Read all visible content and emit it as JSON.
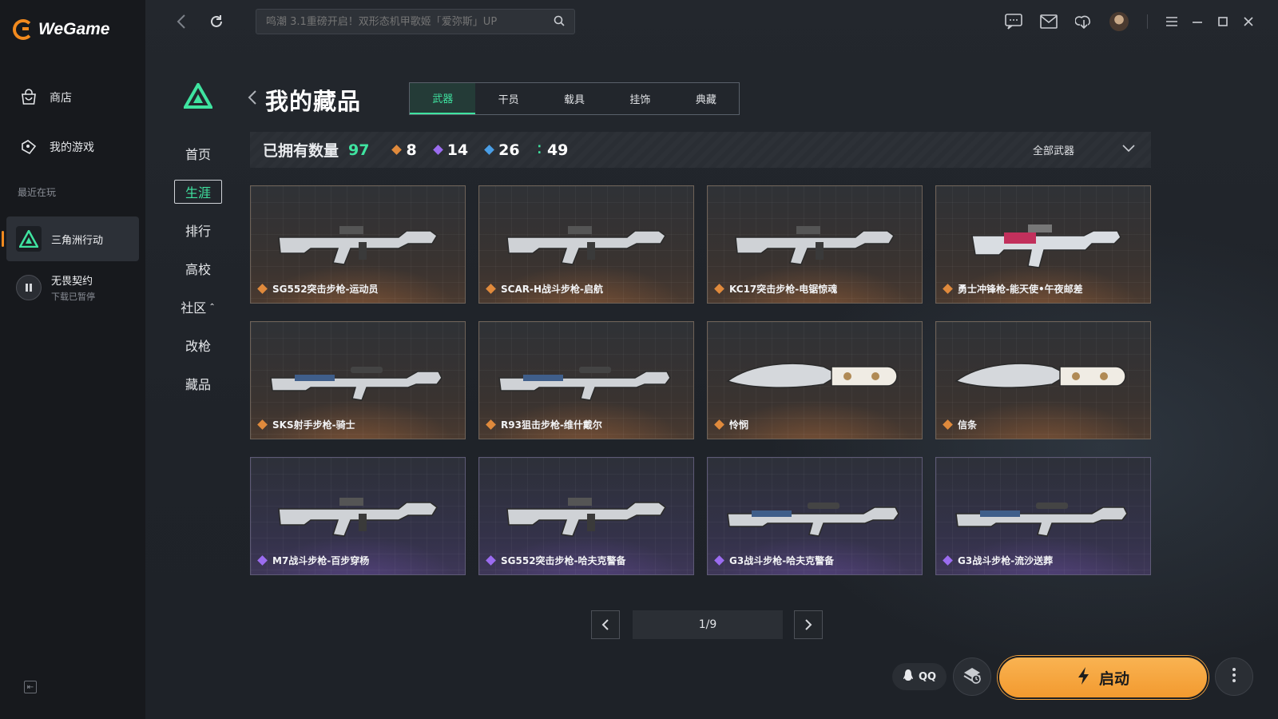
{
  "app": {
    "name": "WeGame",
    "search_placeholder": "鸣潮 3.1重磅开启！双形态机甲歌姬「爱弥斯」UP"
  },
  "sidebar": {
    "items": [
      {
        "label": "商店",
        "icon": "store-bag-icon"
      },
      {
        "label": "我的游戏",
        "icon": "game-controller-icon"
      }
    ],
    "recent_label": "最近在玩",
    "recent_games": [
      {
        "name": "三角洲行动",
        "status": "",
        "active": true
      },
      {
        "name": "无畏契约",
        "status": "下载已暂停",
        "active": false
      }
    ]
  },
  "game_menu": [
    "首页",
    "生涯",
    "排行",
    "高校",
    "社区",
    "改枪",
    "藏品"
  ],
  "game_menu_active": "生涯",
  "page": {
    "title": "我的藏品",
    "tabs": [
      "武器",
      "干员",
      "载具",
      "挂饰",
      "典藏"
    ],
    "active_tab": "武器"
  },
  "stats": {
    "label": "已拥有数量",
    "total": "97",
    "counts": [
      {
        "value": "8",
        "color": "#e08a3c"
      },
      {
        "value": "14",
        "color": "#9b6cf0"
      },
      {
        "value": "26",
        "color": "#4a9ee6"
      },
      {
        "value": "49",
        "color": "#3fe3a0"
      }
    ],
    "filter": "全部武器"
  },
  "items": [
    {
      "name": "SG552突击步枪-运动员",
      "rarity": "gold",
      "rarity_color": "#e08a3c",
      "kind": "rifle"
    },
    {
      "name": "SCAR-H战斗步枪-启航",
      "rarity": "gold",
      "rarity_color": "#e08a3c",
      "kind": "rifle"
    },
    {
      "name": "KC17突击步枪-电锯惊魂",
      "rarity": "gold",
      "rarity_color": "#e08a3c",
      "kind": "rifle"
    },
    {
      "name": "勇士冲锋枪-能天使•午夜邮差",
      "rarity": "gold",
      "rarity_color": "#e08a3c",
      "kind": "smg"
    },
    {
      "name": "SKS射手步枪-骑士",
      "rarity": "gold",
      "rarity_color": "#e08a3c",
      "kind": "sniper"
    },
    {
      "name": "R93狙击步枪-维什戴尔",
      "rarity": "gold",
      "rarity_color": "#e08a3c",
      "kind": "sniper"
    },
    {
      "name": "怜悯",
      "rarity": "gold",
      "rarity_color": "#e08a3c",
      "kind": "knife"
    },
    {
      "name": "信条",
      "rarity": "gold",
      "rarity_color": "#e08a3c",
      "kind": "knife"
    },
    {
      "name": "M7战斗步枪-百步穿杨",
      "rarity": "purple",
      "rarity_color": "#9b6cf0",
      "kind": "rifle"
    },
    {
      "name": "SG552突击步枪-哈夫克警备",
      "rarity": "purple",
      "rarity_color": "#9b6cf0",
      "kind": "rifle"
    },
    {
      "name": "G3战斗步枪-哈夫克警备",
      "rarity": "purple",
      "rarity_color": "#9b6cf0",
      "kind": "sniper"
    },
    {
      "name": "G3战斗步枪-流沙送葬",
      "rarity": "purple",
      "rarity_color": "#9b6cf0",
      "kind": "sniper"
    }
  ],
  "pagination": {
    "text": "1/9"
  },
  "bottom": {
    "qq_label": "QQ",
    "launch_label": "启动"
  },
  "colors": {
    "accent_green": "#3fe3a0",
    "launch_orange": "#f5a43a",
    "brand_orange": "#f28a1e"
  }
}
